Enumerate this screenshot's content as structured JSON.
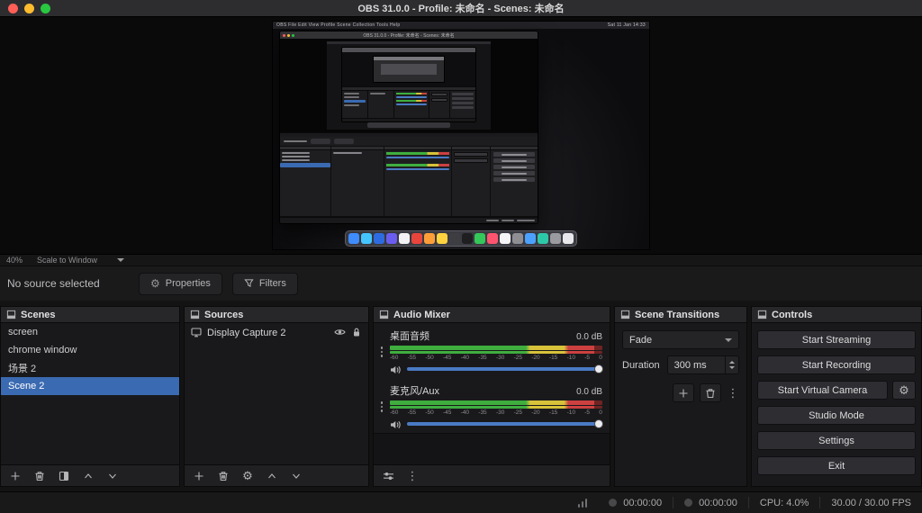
{
  "window": {
    "title": "OBS 31.0.0 - Profile: 未命名 - Scenes: 未命名"
  },
  "icons": {
    "gear": "⚙",
    "kebab": "⋮"
  },
  "preview": {
    "zoom_level": "40%",
    "scale_mode": "Scale to Window",
    "captured_desktop": {
      "menubar_apps": " OBS  File  Edit  View  Profile  Scene Collection  Tools  Help",
      "menubar_clock": "Sat 11 Jan 14:33",
      "obs_window_title": "OBS 31.0.0 - Profile: 未命名 - Scenes: 未命名",
      "dock_icon_colors": [
        "#3f8cff",
        "#45c5ff",
        "#2d6ce0",
        "#6a5df0",
        "#f2f2f4",
        "#e8453c",
        "#ff9e38",
        "#ffd23f",
        "#3e3e42",
        "#1f1f22",
        "#34c759",
        "#ff5470",
        "#f5f5f7",
        "#8e8e93",
        "#4ca1ff",
        "#2dc8a8",
        "#9a9aa0",
        "#e8e8ec"
      ]
    }
  },
  "source_toolbar": {
    "status_text": "No source selected",
    "properties_label": "Properties",
    "filters_label": "Filters"
  },
  "scenes_panel": {
    "title": "Scenes",
    "selected_index": 3,
    "items": [
      {
        "label": "screen"
      },
      {
        "label": "chrome window"
      },
      {
        "label": "场景 2"
      },
      {
        "label": "Scene 2"
      }
    ]
  },
  "sources_panel": {
    "title": "Sources",
    "items": [
      {
        "label": "Display Capture 2"
      }
    ]
  },
  "mixer_panel": {
    "title": "Audio Mixer",
    "channels": [
      {
        "name": "桌面音频",
        "level_db": "0.0 dB",
        "volume_percent": 100
      },
      {
        "name": "麦克风/Aux",
        "level_db": "0.0 dB",
        "volume_percent": 100
      }
    ],
    "scale_ticks": [
      "-60",
      "-55",
      "-50",
      "-45",
      "-40",
      "-35",
      "-30",
      "-25",
      "-20",
      "-15",
      "-10",
      "-5",
      "0"
    ]
  },
  "transitions_panel": {
    "title": "Scene Transitions",
    "selected_transition": "Fade",
    "duration_label": "Duration",
    "duration_value": "300 ms"
  },
  "controls_panel": {
    "title": "Controls",
    "buttons": [
      "Start Streaming",
      "Start Recording",
      "Start Virtual Camera",
      "Studio Mode",
      "Settings",
      "Exit"
    ]
  },
  "status_bar": {
    "rec_timer": "00:00:00",
    "stream_timer": "00:00:00",
    "cpu_usage": "CPU: 4.0%",
    "fps": "30.00 / 30.00 FPS"
  },
  "colors": {
    "selection_blue": "#3a6ab1",
    "slider_blue": "#4a7ac4",
    "meter_green": "#3fae3f",
    "meter_yellow": "#d7c23a",
    "meter_red": "#cc4040"
  }
}
